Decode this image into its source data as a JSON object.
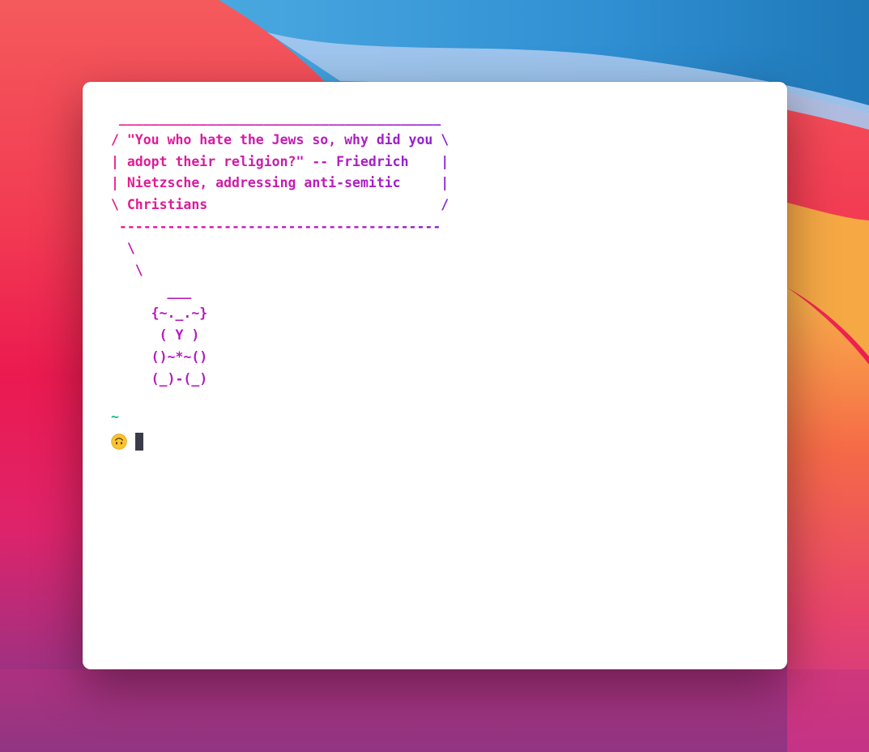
{
  "terminal": {
    "cowsay_bubble": [
      " ________________________________________",
      "/ \"You who hate the Jews so, why did you \\",
      "| adopt their religion?\" -- Friedrich    |",
      "| Nietzsche, addressing anti-semitic     |",
      "\\ Christians                             /",
      " ----------------------------------------"
    ],
    "cowsay_figure": [
      "  \\",
      "   \\",
      "       ___",
      "     {~._.~}",
      "      ( Y )",
      "     ()~*~()",
      "     (_)-(_)"
    ],
    "prompt": {
      "directory": "~",
      "emoji_icon": "upside-down-face-icon"
    }
  },
  "colors": {
    "gradient_start": "#e8198b",
    "gradient_mid": "#c31cb3",
    "gradient_end": "#8b1fd6",
    "prompt_dir": "#17bb8d",
    "cursor": "#3b3b4a",
    "window_bg": "#ffffff"
  }
}
